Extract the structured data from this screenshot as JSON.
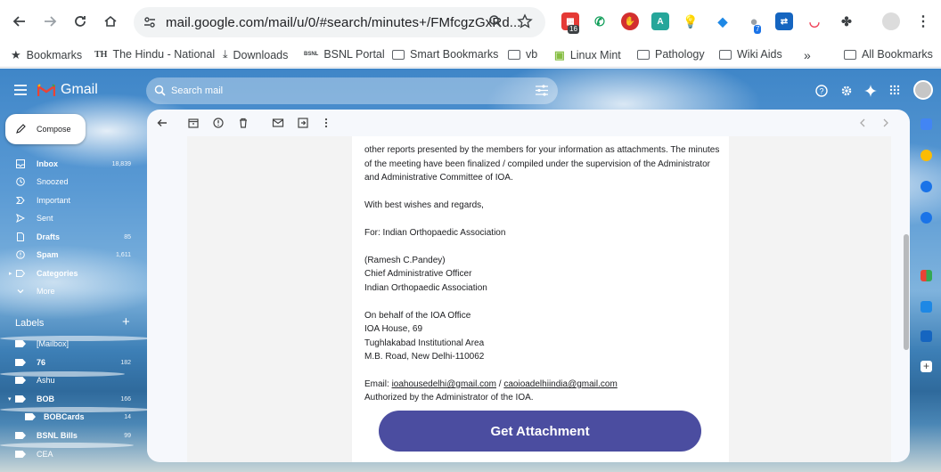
{
  "browser": {
    "url": "mail.google.com/mail/u/0/#search/minutes+/FMfcgzGxRd...",
    "extension_badge_1": "16",
    "extension_badge_2": "7"
  },
  "bookmarks": {
    "items": [
      "Bookmarks",
      "The Hindu - National",
      "Downloads",
      "BSNL Portal",
      "Smart Bookmarks",
      "vb",
      "Linux Mint",
      "Pathology",
      "Wiki Aids"
    ],
    "overflow": "»",
    "all": "All Bookmarks",
    "th_icon": "TH",
    "bsnl_icon": "BSNL"
  },
  "gmail": {
    "brand": "Gmail",
    "search_placeholder": "Search mail",
    "compose": "Compose",
    "nav": [
      {
        "label": "Inbox",
        "count": "18,839"
      },
      {
        "label": "Snoozed",
        "count": ""
      },
      {
        "label": "Important",
        "count": ""
      },
      {
        "label": "Sent",
        "count": ""
      },
      {
        "label": "Drafts",
        "count": "85"
      },
      {
        "label": "Spam",
        "count": "1,611"
      },
      {
        "label": "Categories",
        "count": ""
      },
      {
        "label": "More",
        "count": ""
      }
    ],
    "labels_heading": "Labels",
    "labels": [
      {
        "label": "[Mailbox]",
        "count": ""
      },
      {
        "label": "76",
        "count": "182"
      },
      {
        "label": "Ashu",
        "count": ""
      },
      {
        "label": "BOB",
        "count": "166"
      },
      {
        "label": "BOBCards",
        "count": "14"
      },
      {
        "label": "BSNL Bills",
        "count": "99"
      },
      {
        "label": "CEA",
        "count": ""
      }
    ]
  },
  "email": {
    "line1": "other reports presented by the members for your information as attachments. The minutes of the meeting have been finalized / compiled under the supervision of the Administrator and Administrative Committee of IOA.",
    "greeting": "With best wishes and regards,",
    "for_line": "For: Indian Orthopaedic Association",
    "signer_name": "(Ramesh C.Pandey)",
    "signer_title": "Chief Administrative Officer",
    "signer_org": "Indian Orthopaedic Association",
    "office_line1": "On behalf of the IOA Office",
    "office_line2": "IOA House, 69",
    "office_line3": "Tughlakabad Institutional Area",
    "office_line4": "M.B. Road, New Delhi-110062",
    "email_prefix": "Email: ",
    "email1": "ioahousedelhi@gmail.com",
    "email_sep": " / ",
    "email2": "caoioadelhiindia@gmail.com",
    "authorized": "Authorized by the Administrator of the IOA.",
    "attachment_button": "Get Attachment"
  },
  "colors": {
    "accent_button": "#4b4da0",
    "gmail_red": "#ea4335"
  }
}
